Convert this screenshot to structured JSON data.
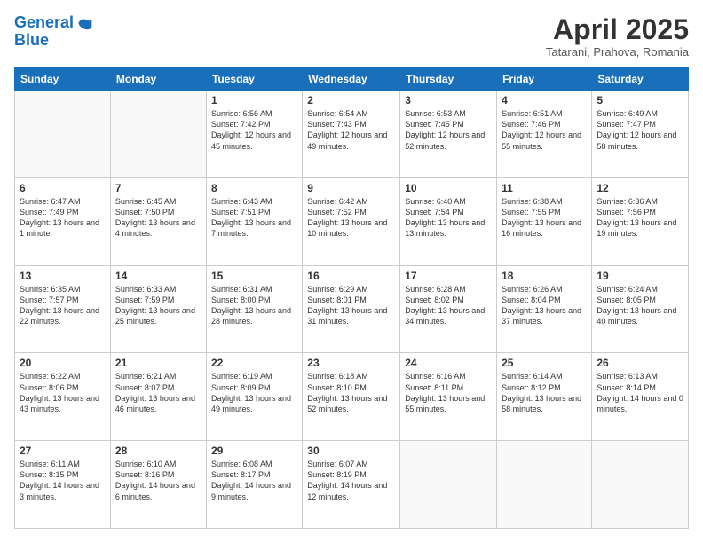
{
  "header": {
    "logo_line1": "General",
    "logo_line2": "Blue",
    "month_title": "April 2025",
    "subtitle": "Tatarani, Prahova, Romania"
  },
  "weekdays": [
    "Sunday",
    "Monday",
    "Tuesday",
    "Wednesday",
    "Thursday",
    "Friday",
    "Saturday"
  ],
  "weeks": [
    [
      {
        "day": "",
        "info": ""
      },
      {
        "day": "",
        "info": ""
      },
      {
        "day": "1",
        "info": "Sunrise: 6:56 AM\nSunset: 7:42 PM\nDaylight: 12 hours and 45 minutes."
      },
      {
        "day": "2",
        "info": "Sunrise: 6:54 AM\nSunset: 7:43 PM\nDaylight: 12 hours and 49 minutes."
      },
      {
        "day": "3",
        "info": "Sunrise: 6:53 AM\nSunset: 7:45 PM\nDaylight: 12 hours and 52 minutes."
      },
      {
        "day": "4",
        "info": "Sunrise: 6:51 AM\nSunset: 7:46 PM\nDaylight: 12 hours and 55 minutes."
      },
      {
        "day": "5",
        "info": "Sunrise: 6:49 AM\nSunset: 7:47 PM\nDaylight: 12 hours and 58 minutes."
      }
    ],
    [
      {
        "day": "6",
        "info": "Sunrise: 6:47 AM\nSunset: 7:49 PM\nDaylight: 13 hours and 1 minute."
      },
      {
        "day": "7",
        "info": "Sunrise: 6:45 AM\nSunset: 7:50 PM\nDaylight: 13 hours and 4 minutes."
      },
      {
        "day": "8",
        "info": "Sunrise: 6:43 AM\nSunset: 7:51 PM\nDaylight: 13 hours and 7 minutes."
      },
      {
        "day": "9",
        "info": "Sunrise: 6:42 AM\nSunset: 7:52 PM\nDaylight: 13 hours and 10 minutes."
      },
      {
        "day": "10",
        "info": "Sunrise: 6:40 AM\nSunset: 7:54 PM\nDaylight: 13 hours and 13 minutes."
      },
      {
        "day": "11",
        "info": "Sunrise: 6:38 AM\nSunset: 7:55 PM\nDaylight: 13 hours and 16 minutes."
      },
      {
        "day": "12",
        "info": "Sunrise: 6:36 AM\nSunset: 7:56 PM\nDaylight: 13 hours and 19 minutes."
      }
    ],
    [
      {
        "day": "13",
        "info": "Sunrise: 6:35 AM\nSunset: 7:57 PM\nDaylight: 13 hours and 22 minutes."
      },
      {
        "day": "14",
        "info": "Sunrise: 6:33 AM\nSunset: 7:59 PM\nDaylight: 13 hours and 25 minutes."
      },
      {
        "day": "15",
        "info": "Sunrise: 6:31 AM\nSunset: 8:00 PM\nDaylight: 13 hours and 28 minutes."
      },
      {
        "day": "16",
        "info": "Sunrise: 6:29 AM\nSunset: 8:01 PM\nDaylight: 13 hours and 31 minutes."
      },
      {
        "day": "17",
        "info": "Sunrise: 6:28 AM\nSunset: 8:02 PM\nDaylight: 13 hours and 34 minutes."
      },
      {
        "day": "18",
        "info": "Sunrise: 6:26 AM\nSunset: 8:04 PM\nDaylight: 13 hours and 37 minutes."
      },
      {
        "day": "19",
        "info": "Sunrise: 6:24 AM\nSunset: 8:05 PM\nDaylight: 13 hours and 40 minutes."
      }
    ],
    [
      {
        "day": "20",
        "info": "Sunrise: 6:22 AM\nSunset: 8:06 PM\nDaylight: 13 hours and 43 minutes."
      },
      {
        "day": "21",
        "info": "Sunrise: 6:21 AM\nSunset: 8:07 PM\nDaylight: 13 hours and 46 minutes."
      },
      {
        "day": "22",
        "info": "Sunrise: 6:19 AM\nSunset: 8:09 PM\nDaylight: 13 hours and 49 minutes."
      },
      {
        "day": "23",
        "info": "Sunrise: 6:18 AM\nSunset: 8:10 PM\nDaylight: 13 hours and 52 minutes."
      },
      {
        "day": "24",
        "info": "Sunrise: 6:16 AM\nSunset: 8:11 PM\nDaylight: 13 hours and 55 minutes."
      },
      {
        "day": "25",
        "info": "Sunrise: 6:14 AM\nSunset: 8:12 PM\nDaylight: 13 hours and 58 minutes."
      },
      {
        "day": "26",
        "info": "Sunrise: 6:13 AM\nSunset: 8:14 PM\nDaylight: 14 hours and 0 minutes."
      }
    ],
    [
      {
        "day": "27",
        "info": "Sunrise: 6:11 AM\nSunset: 8:15 PM\nDaylight: 14 hours and 3 minutes."
      },
      {
        "day": "28",
        "info": "Sunrise: 6:10 AM\nSunset: 8:16 PM\nDaylight: 14 hours and 6 minutes."
      },
      {
        "day": "29",
        "info": "Sunrise: 6:08 AM\nSunset: 8:17 PM\nDaylight: 14 hours and 9 minutes."
      },
      {
        "day": "30",
        "info": "Sunrise: 6:07 AM\nSunset: 8:19 PM\nDaylight: 14 hours and 12 minutes."
      },
      {
        "day": "",
        "info": ""
      },
      {
        "day": "",
        "info": ""
      },
      {
        "day": "",
        "info": ""
      }
    ]
  ]
}
